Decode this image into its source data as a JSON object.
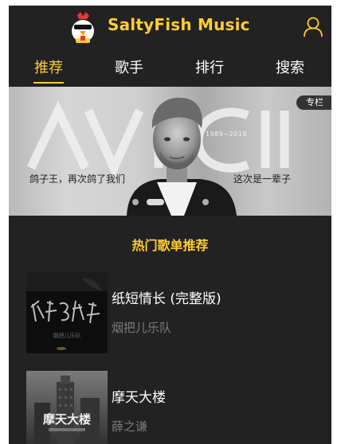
{
  "header": {
    "title": "SaltyFish Music",
    "logo_icon": "chicken-mascot-icon",
    "user_icon": "user-icon"
  },
  "tabs": [
    {
      "label": "推荐",
      "active": true
    },
    {
      "label": "歌手",
      "active": false
    },
    {
      "label": "排行",
      "active": false
    },
    {
      "label": "搜索",
      "active": false
    }
  ],
  "banner": {
    "tag": "专栏",
    "caption_left": "鸽子王，再次鸽了我们",
    "caption_right": "这次是一辈子",
    "year_range": "1989~2018",
    "logo_text": "AVICII",
    "active_slide": 1,
    "slide_count": 3
  },
  "section": {
    "title": "热门歌单推荐"
  },
  "playlists": [
    {
      "name": "纸短情长 (完整版)",
      "artist": "烟把儿乐队",
      "cover_text": "烟把儿乐队"
    },
    {
      "name": "摩天大楼",
      "artist": "薛之谦",
      "cover_text": "摩天大楼"
    }
  ],
  "colors": {
    "background": "#222222",
    "accent": "#ffcd32",
    "text": "#ffffff",
    "muted": "#7a7a7a"
  }
}
